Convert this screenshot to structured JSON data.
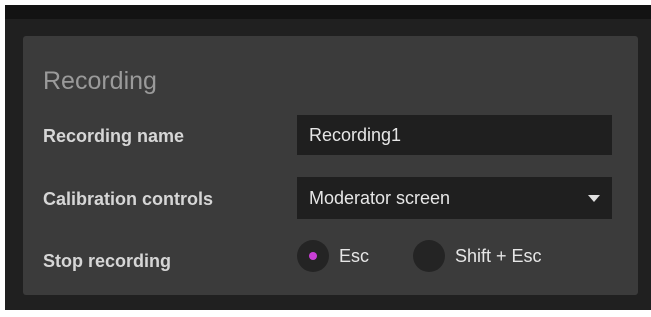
{
  "panel": {
    "title": "Recording",
    "recording_name": {
      "label": "Recording name",
      "value": "Recording1"
    },
    "calibration_controls": {
      "label": "Calibration controls",
      "selected": "Moderator screen"
    },
    "stop_recording": {
      "label": "Stop recording",
      "options": [
        {
          "label": "Esc",
          "selected": true
        },
        {
          "label": "Shift + Esc",
          "selected": false
        }
      ]
    }
  },
  "colors": {
    "accent": "#c93fd6",
    "panel_bg": "#3b3b3b",
    "input_bg": "#1f1f1f"
  }
}
